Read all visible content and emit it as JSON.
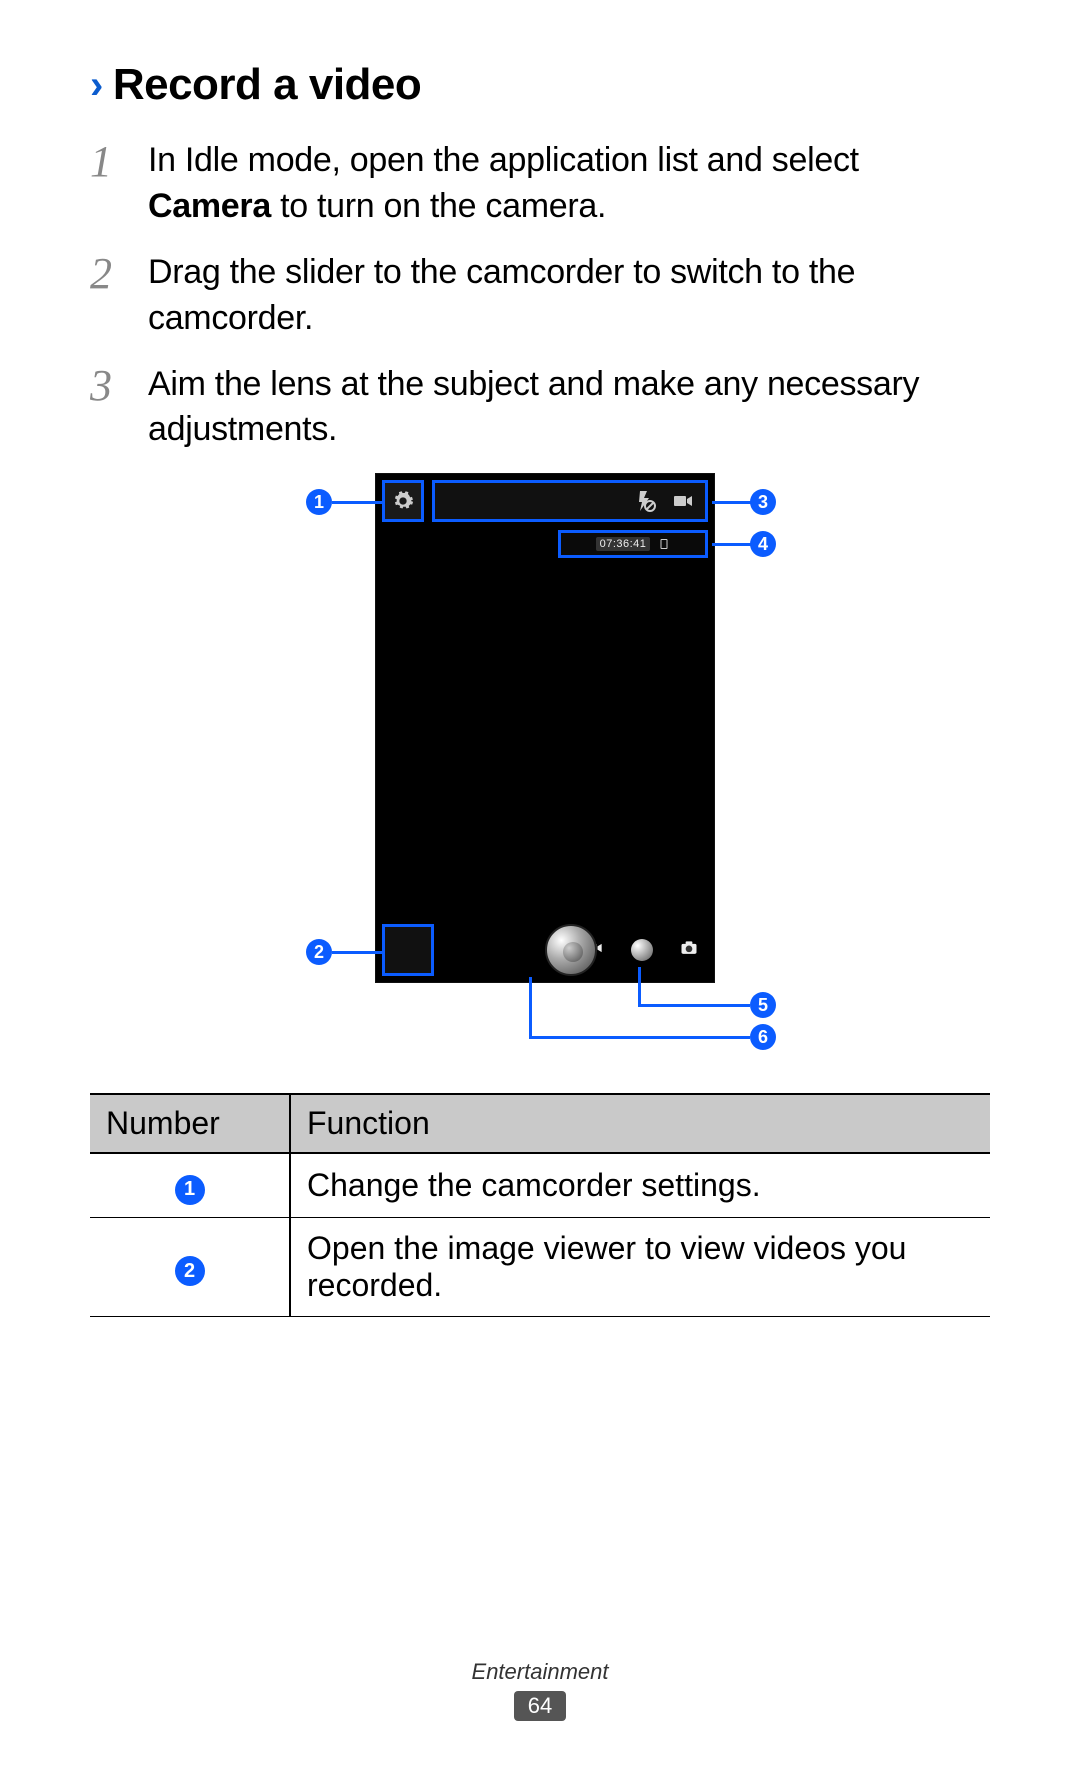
{
  "section": {
    "chevron": "›",
    "title": "Record a video"
  },
  "steps": [
    {
      "num": "1",
      "pre": "In Idle mode, open the application list and select ",
      "bold": "Camera",
      "post": " to turn on the camera."
    },
    {
      "num": "2",
      "pre": "Drag the slider to the camcorder to switch to the camcorder.",
      "bold": "",
      "post": ""
    },
    {
      "num": "3",
      "pre": "Aim the lens at the subject and make any necessary adjustments.",
      "bold": "",
      "post": ""
    }
  ],
  "diagram": {
    "callouts": {
      "c1": "1",
      "c2": "2",
      "c3": "3",
      "c4": "4",
      "c5": "5",
      "c6": "6"
    },
    "time_label": "07:36:41"
  },
  "table": {
    "headers": {
      "number": "Number",
      "function": "Function"
    },
    "rows": [
      {
        "badge": "1",
        "text": "Change the camcorder settings."
      },
      {
        "badge": "2",
        "text": "Open the image viewer to view videos you recorded."
      }
    ]
  },
  "footer": {
    "category": "Entertainment",
    "page": "64"
  }
}
